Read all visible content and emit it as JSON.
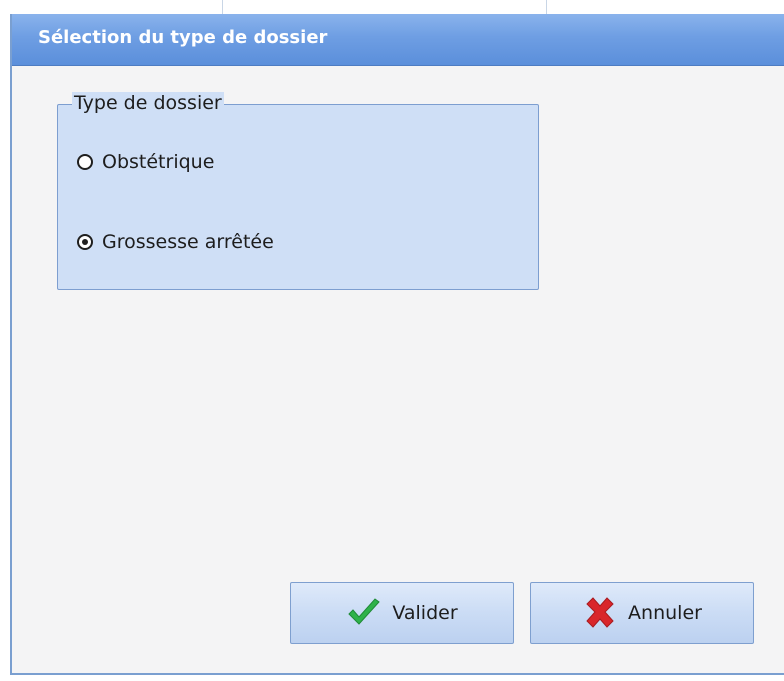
{
  "dialog": {
    "title": "Sélection du type de dossier"
  },
  "group": {
    "legend": "Type de dossier",
    "options": [
      {
        "label": "Obstétrique",
        "checked": false
      },
      {
        "label": "Grossesse arrêtée",
        "checked": true
      }
    ],
    "selected": "Grossesse arrêtée"
  },
  "buttons": {
    "ok_label": "Valider",
    "ok_icon": "checkmark-icon",
    "cancel_label": "Annuler",
    "cancel_icon": "cross-icon"
  },
  "colors": {
    "titlebar": "#6e9ee3",
    "groupbox": "#cfdff6",
    "check_green": "#2fb24a",
    "cross_red": "#d9262b"
  }
}
